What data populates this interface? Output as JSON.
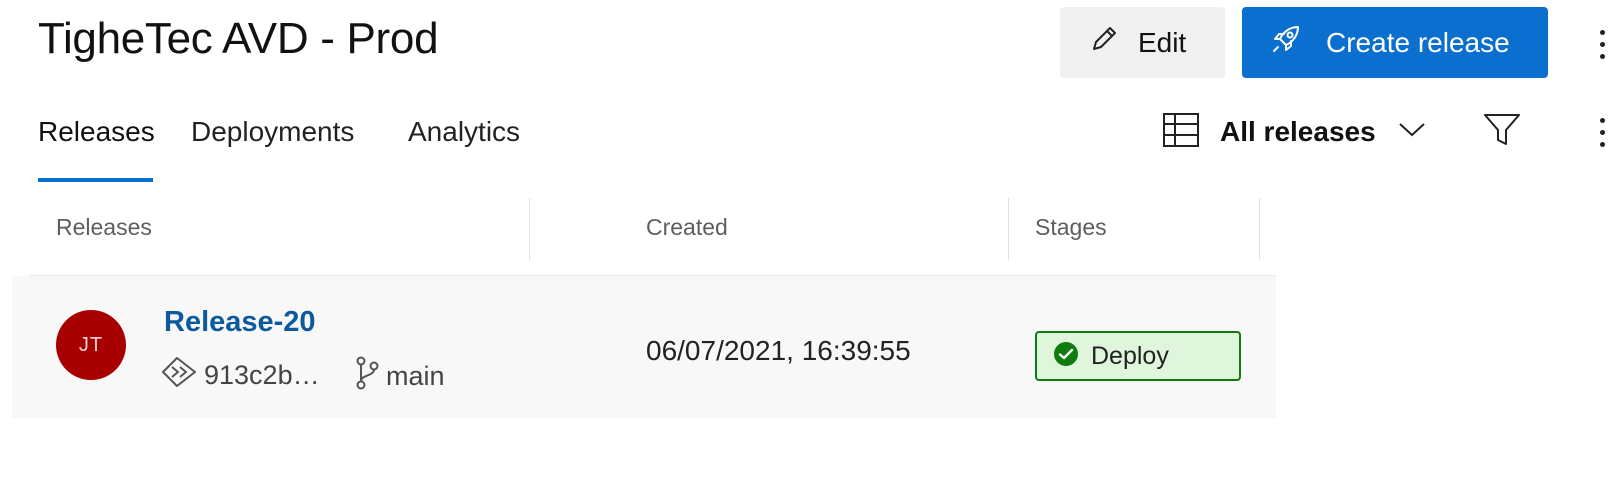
{
  "header": {
    "title": "TigheTec AVD - Prod",
    "edit_label": "Edit",
    "create_label": "Create release"
  },
  "tabs": [
    {
      "label": "Releases",
      "active": true
    },
    {
      "label": "Deployments"
    },
    {
      "label": "Analytics"
    }
  ],
  "view": {
    "selected": "All releases"
  },
  "table": {
    "columns": [
      "Releases",
      "Created",
      "Stages"
    ],
    "rows": [
      {
        "avatar_initials": "JT",
        "name": "Release-20",
        "commit": "913c2b…",
        "branch": "main",
        "created": "06/07/2021, 16:39:55",
        "stage": {
          "label": "Deploy",
          "status": "succeeded"
        }
      }
    ]
  },
  "icons": {
    "edit": "pencil-icon",
    "create": "rocket-icon",
    "view": "table-grid-icon",
    "dropdown": "chevron-down-icon",
    "filter": "filter-icon",
    "more": "more-vertical-icon",
    "commit": "commit-icon",
    "branch": "branch-icon",
    "stage_status": "check-circle-icon"
  },
  "colors": {
    "accent": "#0b6fd0",
    "link": "#0b5a9e",
    "success": "#107c10",
    "success_bg": "#dff6dd",
    "avatar": "#a80000"
  }
}
